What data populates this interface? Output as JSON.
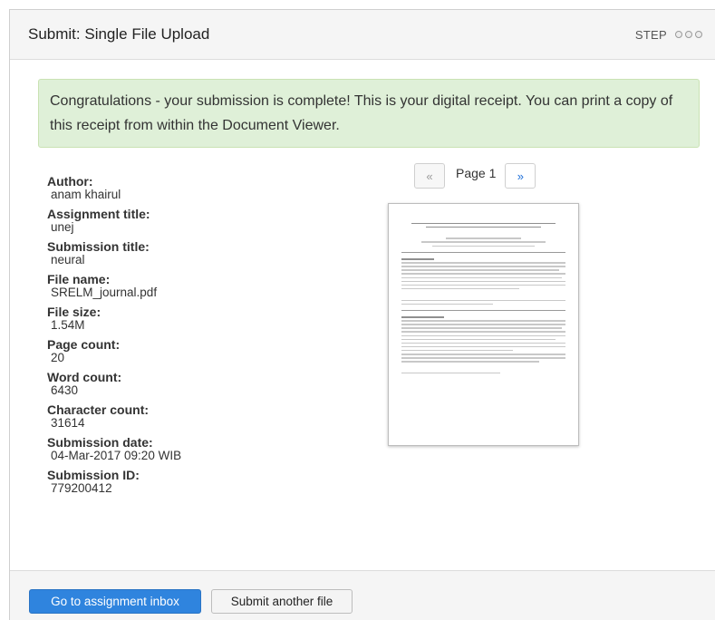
{
  "header": {
    "title": "Submit: Single File Upload",
    "step_label": "STEP"
  },
  "alert": {
    "message": "Congratulations - your submission is complete! This is your digital receipt. You can print a copy of this receipt from within the Document Viewer."
  },
  "receipt": [
    {
      "label": "Author:",
      "value": "anam khairul"
    },
    {
      "label": "Assignment title:",
      "value": "unej"
    },
    {
      "label": "Submission title:",
      "value": "neural"
    },
    {
      "label": "File name:",
      "value": "SRELM_journal.pdf"
    },
    {
      "label": "File size:",
      "value": "1.54M"
    },
    {
      "label": "Page count:",
      "value": "20"
    },
    {
      "label": "Word count:",
      "value": "6430"
    },
    {
      "label": "Character count:",
      "value": "31614"
    },
    {
      "label": "Submission date:",
      "value": "04-Mar-2017 09:20 WIB"
    },
    {
      "label": "Submission ID:",
      "value": "779200412"
    }
  ],
  "viewer": {
    "prev_label": "«",
    "page_label": "Page 1",
    "next_label": "»"
  },
  "footer": {
    "primary_button": "Go to assignment inbox",
    "secondary_button": "Submit another file"
  }
}
